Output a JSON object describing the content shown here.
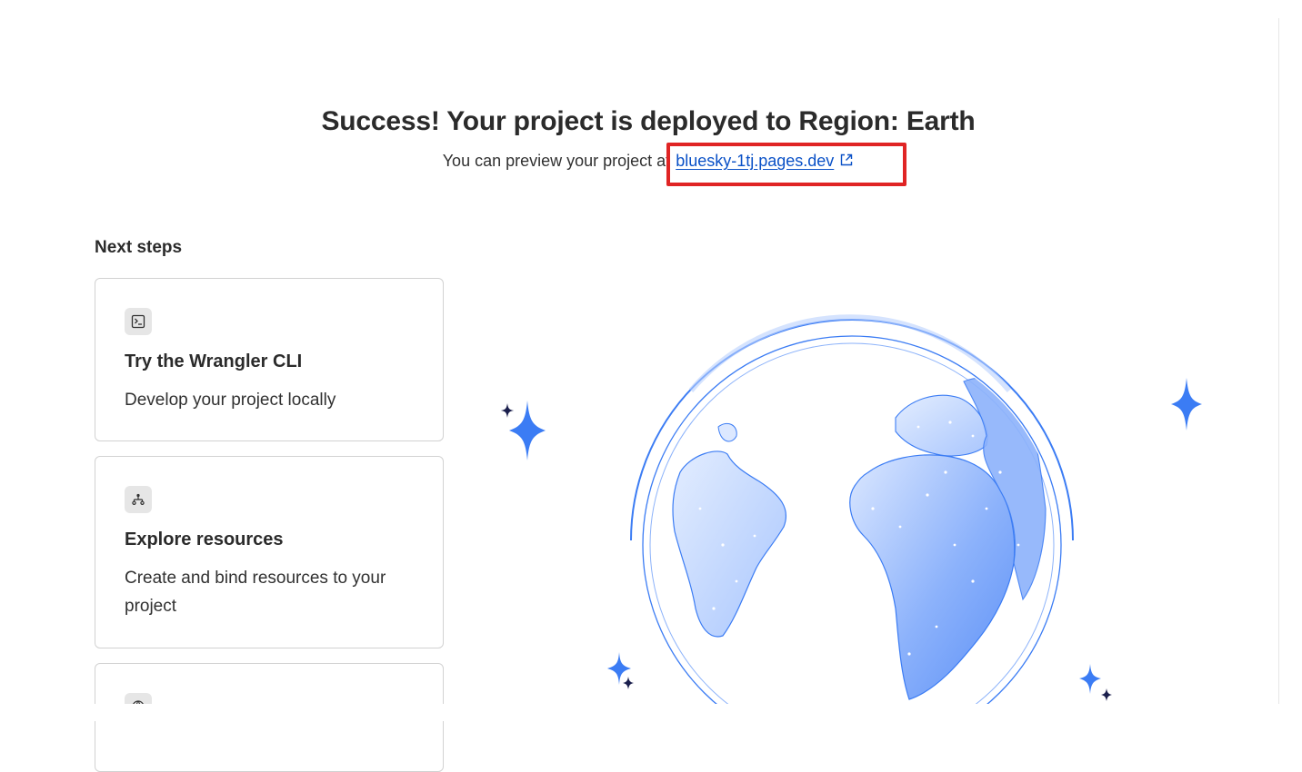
{
  "header": {
    "title": "Success! Your project is deployed to Region: Earth",
    "preview_prefix": "You can preview your project at",
    "preview_link": "bluesky-1tj.pages.dev"
  },
  "next_steps": {
    "heading": "Next steps",
    "cards": [
      {
        "icon": "terminal-icon",
        "title": "Try the Wrangler CLI",
        "description": "Develop your project locally"
      },
      {
        "icon": "resources-tree-icon",
        "title": "Explore resources",
        "description": "Create and bind resources to your project"
      },
      {
        "icon": "globe-icon",
        "title": "",
        "description": ""
      }
    ]
  },
  "colors": {
    "accent_blue": "#0a51c7",
    "highlight_red": "#e02424",
    "globe_blue": "#3b7cf4",
    "star_dark": "#1b1f4d"
  }
}
